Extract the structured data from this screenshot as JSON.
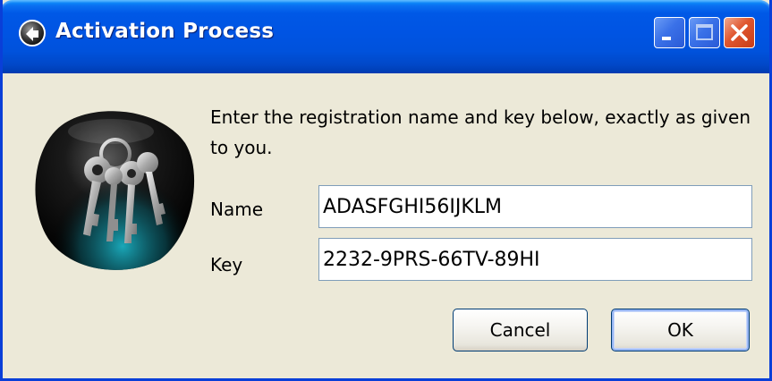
{
  "window": {
    "title": "Activation Process",
    "title_icon": "globe-arrow-icon",
    "controls": {
      "minimize_icon": "minimize-icon",
      "maximize_icon": "maximize-icon",
      "close_icon": "close-icon"
    }
  },
  "dialog": {
    "image_icon": "keys-icon",
    "instructions": "Enter the registration name and key below, exactly as given to you.",
    "name_label": "Name",
    "name_value": "ADASFGHI56IJKLM",
    "key_label": "Key",
    "key_value": "2232-9PRS-66TV-89HI",
    "cancel_label": "Cancel",
    "ok_label": "OK"
  },
  "colors": {
    "titlebar": "#0054e3",
    "window_bg": "#ece9d8",
    "close_button": "#e0562f",
    "input_border": "#7f9db9"
  }
}
